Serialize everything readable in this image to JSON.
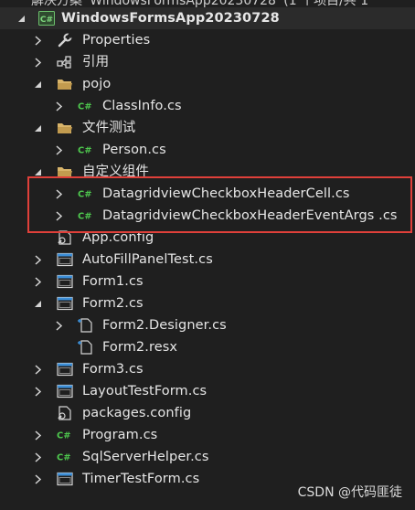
{
  "solution": {
    "partial_title": "解决方案 'WindowsFormsApp20230728' (1 个项目/共 1"
  },
  "project": {
    "name": "WindowsFormsApp20230728",
    "badge": "C#"
  },
  "nodes": [
    {
      "label": "Properties"
    },
    {
      "label": "引用"
    },
    {
      "label": "pojo"
    },
    {
      "label": "ClassInfo.cs"
    },
    {
      "label": "文件测试"
    },
    {
      "label": "Person.cs"
    },
    {
      "label": "自定义组件"
    },
    {
      "label": "DatagridviewCheckboxHeaderCell.cs"
    },
    {
      "label": "DatagridviewCheckboxHeaderEventArgs .cs"
    },
    {
      "label": "App.config"
    },
    {
      "label": "AutoFillPanelTest.cs"
    },
    {
      "label": "Form1.cs"
    },
    {
      "label": "Form2.cs"
    },
    {
      "label": "Form2.Designer.cs"
    },
    {
      "label": "Form2.resx"
    },
    {
      "label": "Form3.cs"
    },
    {
      "label": "LayoutTestForm.cs"
    },
    {
      "label": "packages.config"
    },
    {
      "label": "Program.cs"
    },
    {
      "label": "SqlServerHelper.cs"
    },
    {
      "label": "TimerTestForm.cs"
    }
  ],
  "watermark": "CSDN @代码匪徒",
  "colors": {
    "background": "#1f1f1f",
    "text": "#e6e6e6",
    "csharp_green": "#4ec94e",
    "folder_tan": "#d8b46a",
    "form_blue": "#3c8fd9",
    "highlight_red": "#e0403a"
  }
}
